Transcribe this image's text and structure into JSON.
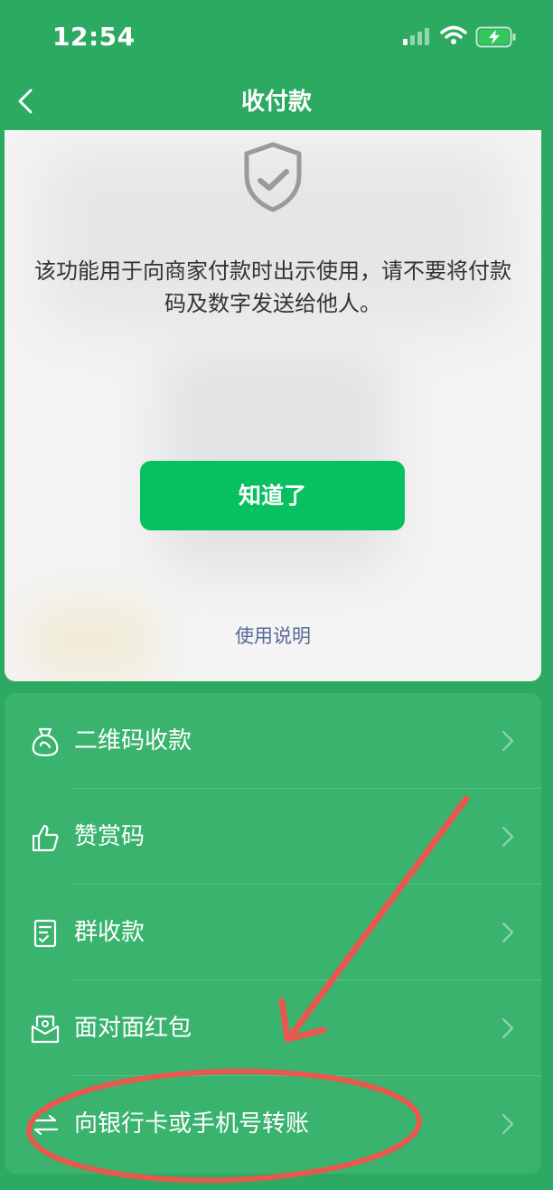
{
  "status_bar": {
    "time": "12:54"
  },
  "nav": {
    "title": "收付款"
  },
  "notice": {
    "message": "该功能用于向商家付款时出示使用，请不要将付款码及数字发送给他人。",
    "ok_label": "知道了",
    "help_label": "使用说明"
  },
  "menu": {
    "items": [
      {
        "label": "二维码收款",
        "icon": "money-bag-icon"
      },
      {
        "label": "赞赏码",
        "icon": "thumbs-up-icon"
      },
      {
        "label": "群收款",
        "icon": "receipt-icon"
      },
      {
        "label": "面对面红包",
        "icon": "red-envelope-icon"
      },
      {
        "label": "向银行卡或手机号转账",
        "icon": "transfer-arrows-icon"
      }
    ]
  },
  "colors": {
    "background": "#2daa62",
    "menu_card": "#3ab36f",
    "primary_button": "#07c160",
    "link": "#576b95",
    "annotation": "#e8584f"
  }
}
